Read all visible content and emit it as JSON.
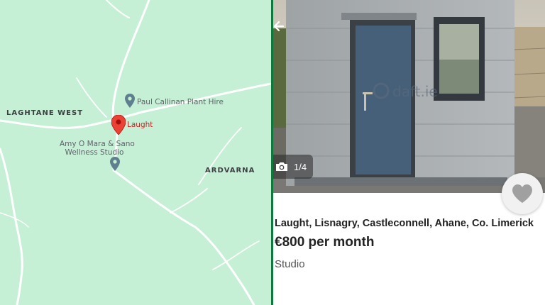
{
  "map": {
    "areas": {
      "laghtane_west": "LAGHTANE WEST",
      "ardvarna": "ARDVARNA"
    },
    "pois": {
      "plant_hire": "Paul Callinan Plant Hire",
      "wellness_line1": "Amy O Mara & Sano",
      "wellness_line2": "Wellness Studio"
    },
    "selected_pin": "Laught",
    "colors": {
      "background": "#c5f0d6",
      "road": "#ffffff",
      "pin": "#ea4335",
      "poi_pin": "#5f7f8e"
    }
  },
  "listing": {
    "photo_counter": "1/4",
    "watermark": "daft.ie",
    "address": "Laught, Lisnagry, Castleconnell, Ahane, Co. Limerick",
    "price": "€800 per month",
    "property_type": "Studio",
    "icons": [
      "back-arrow-icon",
      "camera-icon",
      "heart-icon"
    ]
  }
}
